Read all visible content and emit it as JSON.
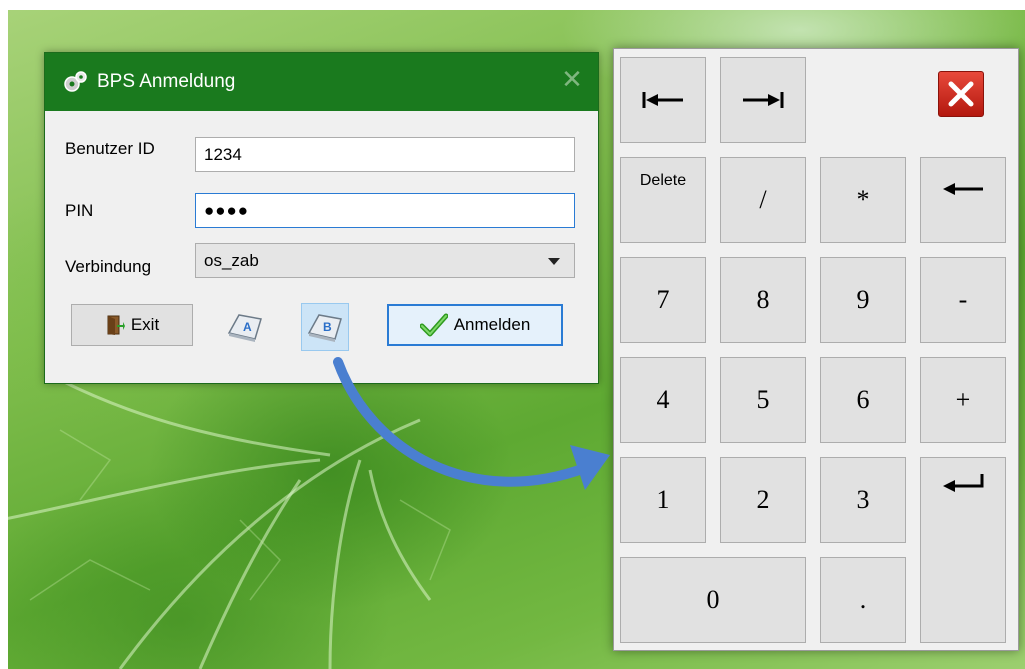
{
  "dialog": {
    "title": "BPS Anmeldung",
    "close_symbol": "✕",
    "fields": {
      "user_id_label": "Benutzer ID",
      "user_id_value": "1234",
      "pin_label": "PIN",
      "pin_value": "●●●●",
      "connection_label": "Verbindung",
      "connection_value": "os_zab"
    },
    "buttons": {
      "exit_label": "Exit",
      "login_label": "Anmelden"
    },
    "keyboard_a_icon": "keyboard-key-a-icon",
    "keyboard_b_icon": "keyboard-key-b-icon"
  },
  "numpad": {
    "keys": {
      "home": "home-arrow-icon",
      "end": "end-arrow-icon",
      "close": "close-icon",
      "delete": "Delete",
      "divide": "/",
      "multiply": "*",
      "backspace": "backspace-arrow-icon",
      "seven": "7",
      "eight": "8",
      "nine": "9",
      "minus": "-",
      "four": "4",
      "five": "5",
      "six": "6",
      "plus": "+",
      "one": "1",
      "two": "2",
      "three": "3",
      "enter": "enter-arrow-icon",
      "zero": "0",
      "decimal": "."
    }
  },
  "colors": {
    "titlebar": "#1a7a1e",
    "arrow": "#4a7fd0",
    "focus_border": "#2a7bd4"
  }
}
